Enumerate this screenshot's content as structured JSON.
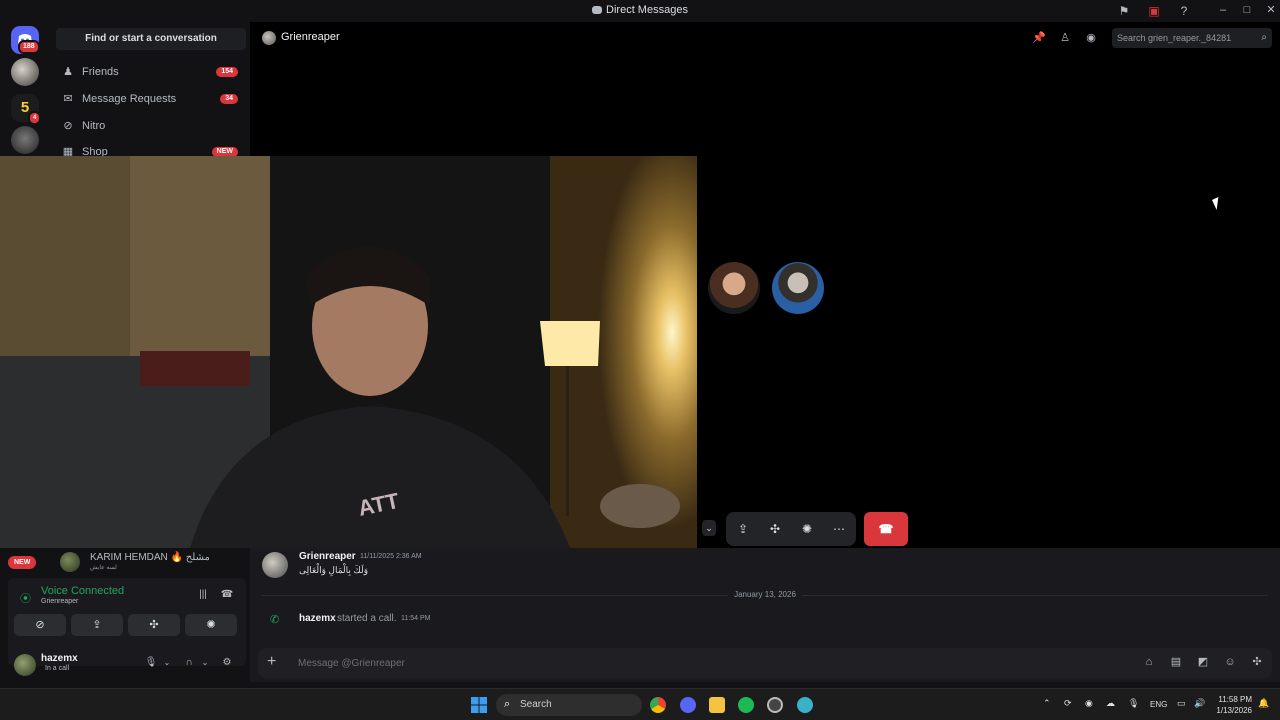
{
  "window": {
    "title": "Direct Messages"
  },
  "rail": {
    "home_badge": "188",
    "server_badge_1": "5",
    "server_badge_2": "4",
    "server_short": "5"
  },
  "sidebar": {
    "find_label": "Find or start a conversation",
    "items": [
      {
        "label": "Friends",
        "count": "154",
        "icon": "friends-icon"
      },
      {
        "label": "Message Requests",
        "count": "34",
        "icon": "mail-icon"
      },
      {
        "label": "Nitro",
        "count": "",
        "icon": "nitro-icon"
      },
      {
        "label": "Shop",
        "count": "NEW",
        "icon": "shop-icon"
      }
    ]
  },
  "header": {
    "name": "Grienreaper",
    "search_placeholder": "Search grien_reaper._84281"
  },
  "chat": {
    "msg_author": "Grienreaper",
    "msg_time": "11/11/2025 2:36 AM",
    "msg_text": "وَلَكَ بِالْمَالِ وَالْعَالِى",
    "date_divider": "January 13, 2026",
    "sys_name": "hazemx",
    "sys_text": "started a call.",
    "sys_time": "11:54 PM",
    "composer_placeholder": "Message @Grienreaper"
  },
  "dm_list": {
    "new_label": "NEW",
    "name": "KARIM HEMDAN 🔥 مشلح",
    "status": "لسه عايش"
  },
  "voice": {
    "status": "Voice Connected",
    "channel": "Grienreaper"
  },
  "user": {
    "name": "hazemx",
    "status": "In a call"
  },
  "taskbar": {
    "search_label": "Search",
    "lang": "ENG",
    "time": "11:58 PM",
    "date": "1/13/2026"
  },
  "colors": {
    "accent": "#5865f2",
    "danger": "#da373c",
    "online": "#23a55a",
    "background": "#121214"
  }
}
